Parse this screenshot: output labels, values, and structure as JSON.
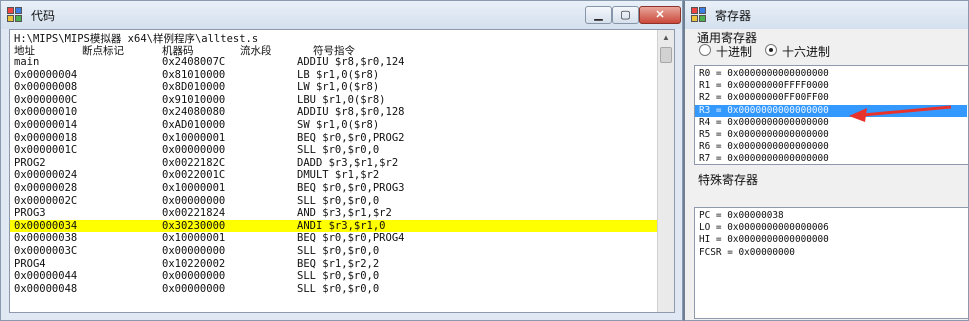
{
  "code_window": {
    "title": "代码",
    "minimize_glyph": "▁",
    "maximize_glyph": "▢",
    "close_glyph": "✕",
    "path": "H:\\MIPS\\MIPS模拟器 x64\\样例程序\\alltest.s",
    "headers": [
      "地址",
      "断点标记",
      "机器码",
      "流水段",
      "符号指令"
    ],
    "rows": [
      [
        "main",
        "0x2408007C",
        "ADDIU $r8,$r0,124"
      ],
      [
        "0x00000004",
        "0x81010000",
        "LB $r1,0($r8)"
      ],
      [
        "0x00000008",
        "0x8D010000",
        "LW $r1,0($r8)"
      ],
      [
        "0x0000000C",
        "0x91010000",
        "LBU $r1,0($r8)"
      ],
      [
        "0x00000010",
        "0x24080080",
        "ADDIU $r8,$r0,128"
      ],
      [
        "0x00000014",
        "0xAD010000",
        "SW $r1,0($r8)"
      ],
      [
        "0x00000018",
        "0x10000001",
        "BEQ $r0,$r0,PROG2"
      ],
      [
        "0x0000001C",
        "0x00000000",
        "SLL $r0,$r0,0"
      ],
      [
        "PROG2",
        "0x0022182C",
        "DADD $r3,$r1,$r2"
      ],
      [
        "0x00000024",
        "0x0022001C",
        "DMULT $r1,$r2"
      ],
      [
        "0x00000028",
        "0x10000001",
        "BEQ $r0,$r0,PROG3"
      ],
      [
        "0x0000002C",
        "0x00000000",
        "SLL $r0,$r0,0"
      ],
      [
        "PROG3",
        "0x00221824",
        "AND $r3,$r1,$r2"
      ],
      [
        "0x00000034",
        "0x30230000",
        "ANDI $r3,$r1,0"
      ],
      [
        "0x00000038",
        "0x10000001",
        "BEQ $r0,$r0,PROG4"
      ],
      [
        "0x0000003C",
        "0x00000000",
        "SLL $r0,$r0,0"
      ],
      [
        "PROG4",
        "0x10220002",
        "BEQ $r1,$r2,2"
      ],
      [
        "0x00000044",
        "0x00000000",
        "SLL $r0,$r0,0"
      ],
      [
        "0x00000048",
        "0x00000000",
        "SLL $r0,$r0,0"
      ]
    ],
    "highlight_color": "#ffff00",
    "scroll_up_glyph": "▲"
  },
  "register_window": {
    "title": "寄存器",
    "general_label": "通用寄存器",
    "radio_dec": "十进制",
    "radio_hex": "十六进制",
    "general_registers": [
      "R0 = 0x0000000000000000",
      "R1 = 0x00000000FFFF0000",
      "R2 = 0x00000000FF00FF00",
      "R3 = 0x0000000000000000",
      "R4 = 0x0000000000000000",
      "R5 = 0x0000000000000000",
      "R6 = 0x0000000000000000",
      "R7 = 0x0000000000000000"
    ],
    "special_label": "特殊寄存器",
    "special_registers": [
      "PC = 0x00000038",
      "LO = 0x0000000000000006",
      "HI = 0x0000000000000000",
      "FCSR = 0x00000000"
    ],
    "selection_color": "#3399ff",
    "annotation_arrow_color": "#e8322c"
  }
}
